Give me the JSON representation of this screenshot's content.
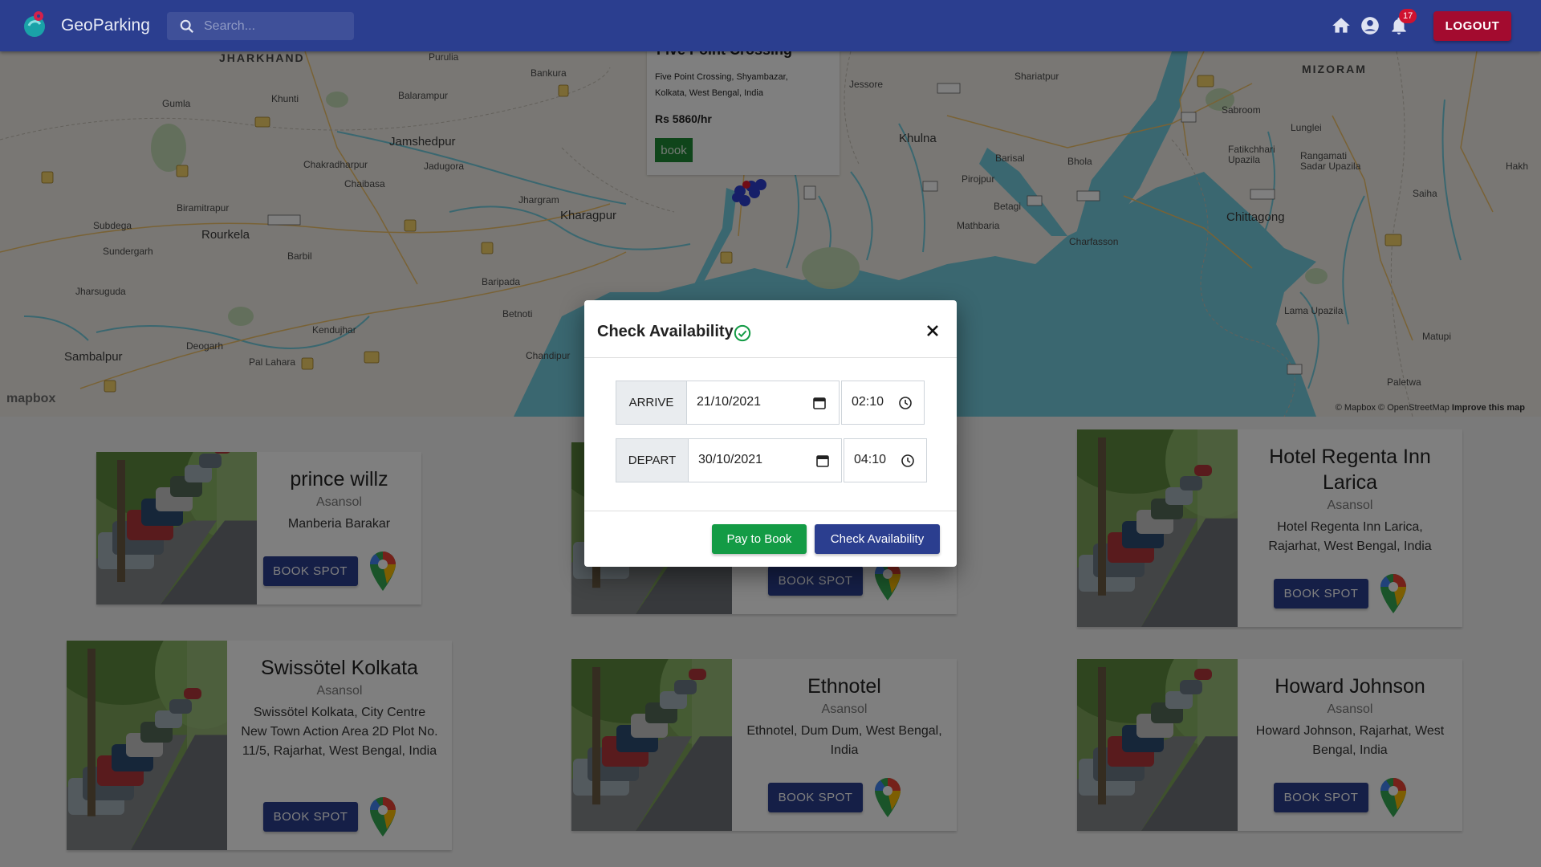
{
  "navbar": {
    "brand": "GeoParking",
    "search_placeholder": "Search...",
    "notification_count": "17",
    "logout_label": "LOGOUT"
  },
  "map": {
    "labels": {
      "jharkhand": "JHARKHAND",
      "mizoram": "MIZORAM",
      "purulia": "Purulia",
      "bankura": "Bankura",
      "gumla": "Gumla",
      "khunti": "Khunti",
      "balarampur": "Balarampur",
      "jamshedpur": "Jamshedpur",
      "chakradharpur": "Chakradharpur",
      "jadugora": "Jadugora",
      "chaibasa": "Chaibasa",
      "biramitrapur": "Biramitrapur",
      "jhargram": "Jhargram",
      "kharagpur": "Kharagpur",
      "subdega": "Subdega",
      "rourkela": "Rourkela",
      "sundergarh": "Sundergarh",
      "barbil": "Barbil",
      "baripada": "Baripada",
      "jharsuguda": "Jharsuguda",
      "betnoti": "Betnoti",
      "kendujhar": "Kendujhar",
      "deogarh": "Deogarh",
      "sambalpur": "Sambalpur",
      "pal_lahara": "Pal Lahara",
      "chandipur": "Chandipur",
      "jessore": "Jessore",
      "shariatpur": "Shariatpur",
      "sabroom": "Sabroom",
      "lunglei": "Lunglei",
      "khulna": "Khulna",
      "barisal": "Barisal",
      "bhola": "Bhola",
      "fatikchhari": "Fatikchhari Upazila",
      "rangamati": "Rangamati Sadar Upazila",
      "pirojpur": "Pirojpur",
      "betagi": "Betagi",
      "saiha": "Saiha",
      "chittagong": "Chittagong",
      "mathbaria": "Mathbaria",
      "charfasson": "Charfasson",
      "lama": "Lama Upazila",
      "matupi": "Matupi",
      "paletwa": "Paletwa",
      "hakha": "Hakh"
    },
    "mapbox_logo": "mapbox",
    "attribution": "© Mapbox © OpenStreetMap",
    "improve": "Improve this map",
    "popup": {
      "title": "Five Point Crossing",
      "address": "Five Point Crossing, Shyambazar, Kolkata, West Bengal, India",
      "price": "Rs 5860/hr",
      "book_label": "book"
    }
  },
  "cards": [
    {
      "name": "prince willz",
      "city": "Asansol",
      "address": "Manberia Barakar",
      "button": "BOOK SPOT"
    },
    {
      "name": "",
      "city": "",
      "address": "",
      "button": "BOOK SPOT"
    },
    {
      "name": "Hotel Regenta Inn Larica",
      "city": "Asansol",
      "address": "Hotel Regenta Inn Larica, Rajarhat, West Bengal, India",
      "button": "BOOK SPOT"
    },
    {
      "name": "Swissötel Kolkata",
      "city": "Asansol",
      "address": "Swissötel Kolkata, City Centre New Town Action Area 2D Plot No. 11/5, Rajarhat, West Bengal, India",
      "button": "BOOK SPOT"
    },
    {
      "name": "Ethnotel",
      "city": "Asansol",
      "address": "Ethnotel, Dum Dum, West Bengal, India",
      "button": "BOOK SPOT"
    },
    {
      "name": "Howard Johnson",
      "city": "Asansol",
      "address": "Howard Johnson, Rajarhat, West Bengal, India",
      "button": "BOOK SPOT"
    }
  ],
  "modal": {
    "title": "Check Availability",
    "arrive_label": "ARRIVE",
    "arrive_date": "21/10/2021",
    "arrive_time": "02:10",
    "depart_label": "DEPART",
    "depart_date": "30/10/2021",
    "depart_time": "04:10",
    "pay_label": "Pay to Book",
    "check_label": "Check Availability"
  },
  "colors": {
    "navbar": "#2b3e8f",
    "logout": "#a30b2f",
    "pay": "#139b45",
    "primary_button": "#2b3e8f",
    "water": "#75cfe0"
  },
  "icons": [
    "search-icon",
    "home-icon",
    "account-icon",
    "bell-icon",
    "check-circle-icon",
    "close-icon",
    "calendar-icon",
    "clock-icon",
    "map-pin-icon"
  ]
}
